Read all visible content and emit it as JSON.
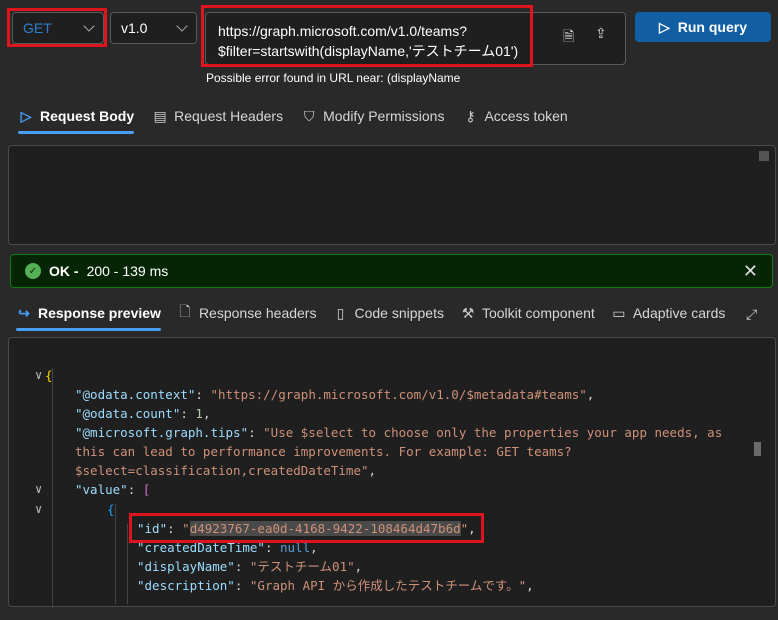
{
  "query": {
    "method": "GET",
    "version": "v1.0",
    "url_line1": "https://graph.microsoft.com/v1.0/teams?",
    "url_line2": "$filter=startswith(displayName,'テストチーム01')",
    "error": "Possible error found in URL near: (displayName",
    "run_label": "Run query"
  },
  "request_tabs": [
    "Request Body",
    "Request Headers",
    "Modify Permissions",
    "Access token"
  ],
  "status": {
    "ok": "OK -",
    "detail": "200 - 139 ms"
  },
  "response_tabs": [
    "Response preview",
    "Response headers",
    "Code snippets",
    "Toolkit component",
    "Adaptive cards"
  ],
  "json": {
    "open": "{",
    "ctx_key": "\"@odata.context\"",
    "ctx_val": "\"https://graph.microsoft.com/v1.0/$metadata#teams\"",
    "count_key": "\"@odata.count\"",
    "count_val": "1",
    "tips_key": "\"@microsoft.graph.tips\"",
    "tips_val1": "\"Use $select to choose only the properties your app needs, as",
    "tips_val2": "this can lead to performance improvements. For example: GET teams?",
    "tips_val3": "$select=classification,createdDateTime\"",
    "value_key": "\"value\"",
    "arr_open": "[",
    "obj_open": "{",
    "id_key": "\"id\"",
    "id_val": "d4923767-ea0d-4168-9422-108464d47b6d",
    "created_key": "\"createdDateTime\"",
    "created_val": "null",
    "name_key": "\"displayName\"",
    "name_val": "\"テストチーム01\"",
    "desc_key": "\"description\"",
    "desc_val": "\"Graph API から作成したテストチームです。\""
  }
}
